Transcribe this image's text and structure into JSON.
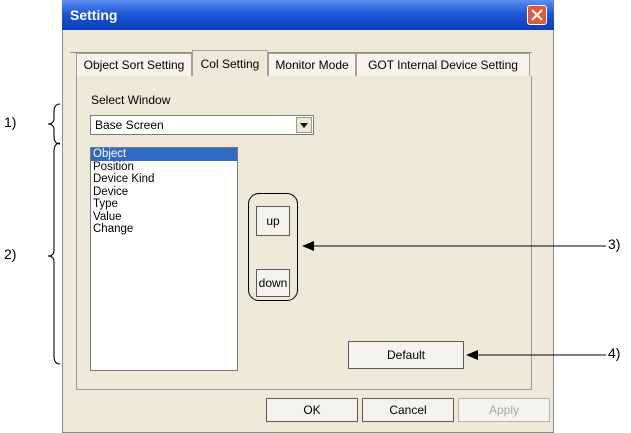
{
  "dialog": {
    "title": "Setting",
    "tabs": [
      "Object Sort Setting",
      "Col Setting",
      "Monitor Mode",
      "GOT Internal Device Setting"
    ],
    "active_tab": "Col Setting",
    "select_window_label": "Select Window",
    "select_window_value": "Base Screen",
    "list_items": [
      "Object",
      "Position",
      "Device Kind",
      "Device",
      "Type",
      "Value",
      "Change"
    ],
    "selected_item": "Object",
    "up_label": "up",
    "down_label": "down",
    "default_label": "Default",
    "ok_label": "OK",
    "cancel_label": "Cancel",
    "apply_label": "Apply"
  },
  "callouts": {
    "c1": "1)",
    "c2": "2)",
    "c3": "3)",
    "c4": "4)"
  },
  "icons": {
    "close": "close-icon",
    "dropdown": "chevron-down-icon"
  }
}
